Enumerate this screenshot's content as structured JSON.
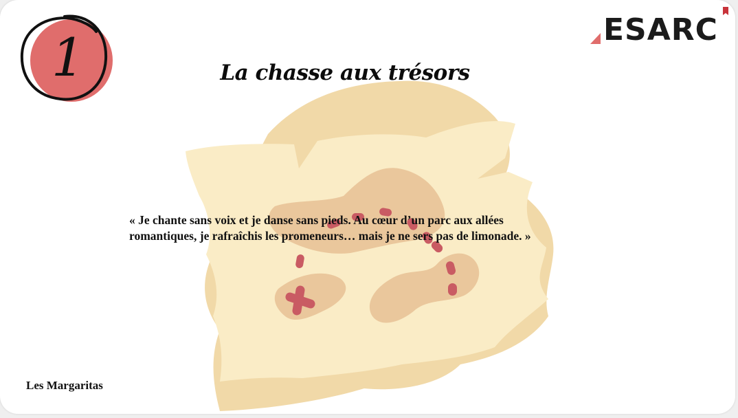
{
  "slide": {
    "number": "1",
    "title": "La chasse aux trésors",
    "riddle_line1": "« Je chante sans voix et je danse sans pieds. Au cœur d’un parc aux allées",
    "riddle_line2": "romantiques, je rafraîchis les promeneurs… mais je ne sers pas de limonade. »",
    "team_name": "Les Margaritas"
  },
  "logo": {
    "text": "ESARC"
  },
  "colors": {
    "badge": "#e06d6c",
    "map_paper": "#f9e6b9",
    "map_shade": "#efd5a4",
    "map_islands": "#e8c39a",
    "trail": "#c95b63",
    "logo_accent": "#c8333a"
  },
  "icons": {
    "map": "treasure-map-illustration",
    "marker": "x-marks-the-spot-icon"
  }
}
